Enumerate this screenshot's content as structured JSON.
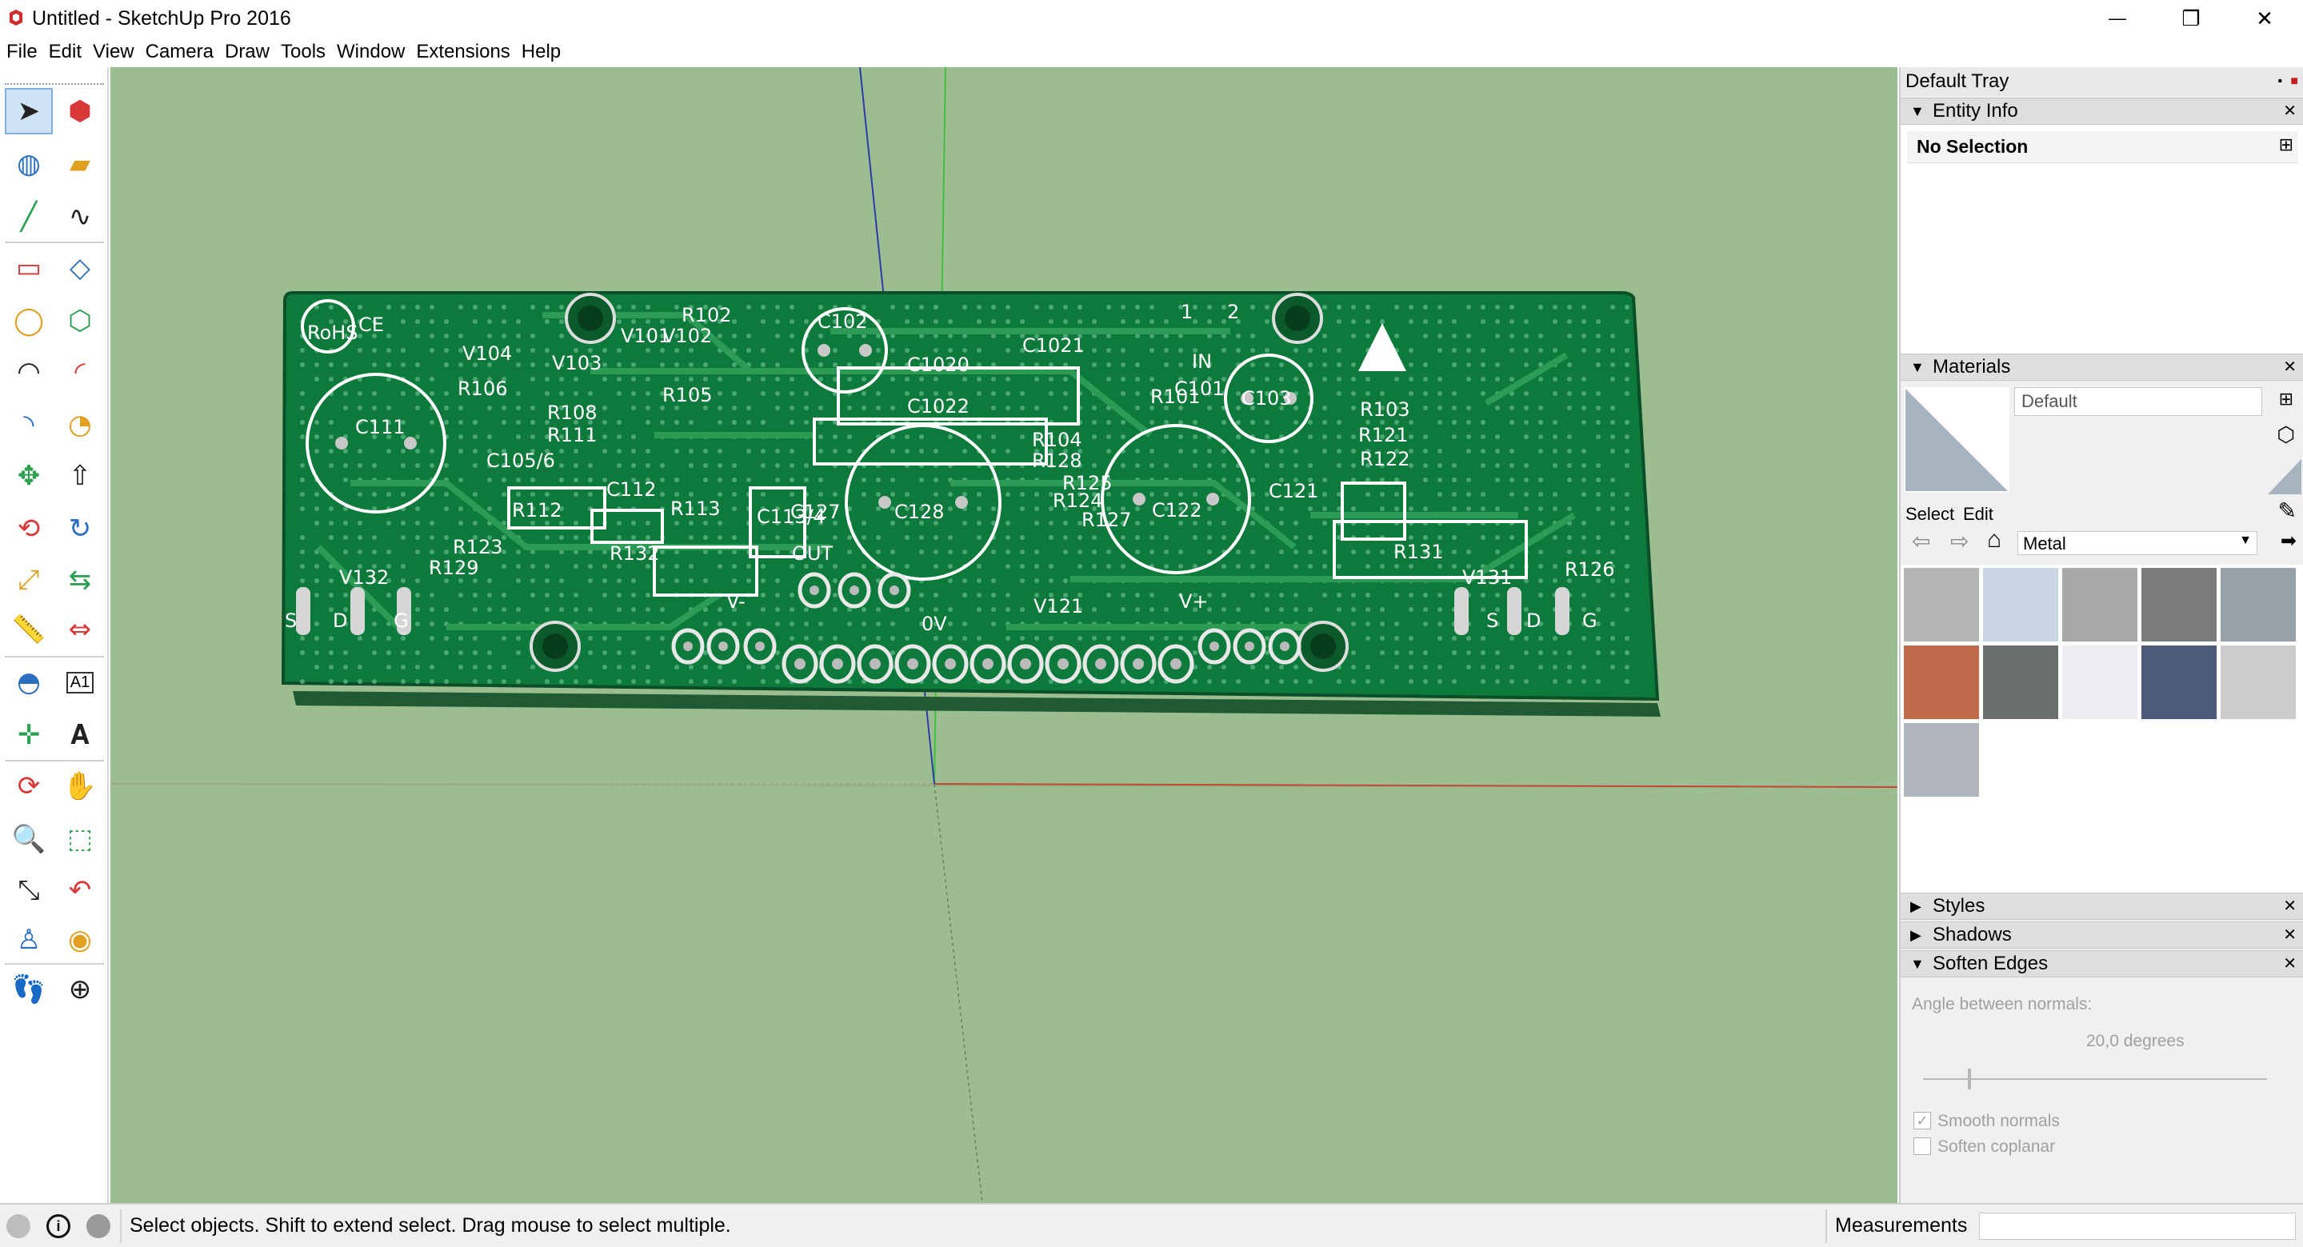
{
  "window": {
    "title": "Untitled - SketchUp Pro 2016",
    "minimize_glyph": "—",
    "maximize_glyph": "❐",
    "close_glyph": "✕"
  },
  "menu": [
    "File",
    "Edit",
    "View",
    "Camera",
    "Draw",
    "Tools",
    "Window",
    "Extensions",
    "Help"
  ],
  "toolbar": {
    "tools": [
      {
        "name": "select-icon"
      },
      {
        "name": "make-component-icon"
      },
      {
        "name": "paint-bucket-icon"
      },
      {
        "name": "eraser-icon"
      },
      {
        "name": "line-icon"
      },
      {
        "name": "freehand-icon"
      },
      {
        "name": "rectangle-icon"
      },
      {
        "name": "rotated-rectangle-icon"
      },
      {
        "name": "circle-icon"
      },
      {
        "name": "polygon-icon"
      },
      {
        "name": "arc-icon"
      },
      {
        "name": "two-point-arc-icon"
      },
      {
        "name": "three-point-arc-icon"
      },
      {
        "name": "pie-icon"
      },
      {
        "name": "move-icon"
      },
      {
        "name": "push-pull-icon"
      },
      {
        "name": "rotate-icon"
      },
      {
        "name": "follow-me-icon"
      },
      {
        "name": "scale-icon"
      },
      {
        "name": "offset-icon"
      },
      {
        "name": "tape-measure-icon"
      },
      {
        "name": "dimension-icon"
      },
      {
        "name": "protractor-icon"
      },
      {
        "name": "text-icon"
      },
      {
        "name": "axes-icon"
      },
      {
        "name": "3d-text-icon"
      },
      {
        "name": "orbit-icon"
      },
      {
        "name": "pan-icon"
      },
      {
        "name": "zoom-icon"
      },
      {
        "name": "zoom-window-icon"
      },
      {
        "name": "zoom-extents-icon"
      },
      {
        "name": "previous-view-icon"
      },
      {
        "name": "position-camera-icon"
      },
      {
        "name": "look-around-icon"
      },
      {
        "name": "walk-icon"
      },
      {
        "name": "section-plane-icon"
      }
    ],
    "dimension_text": "A1"
  },
  "tray": {
    "title": "Default Tray",
    "entity_info": {
      "header": "Entity Info",
      "selection": "No Selection"
    },
    "materials": {
      "header": "Materials",
      "current_name": "Default",
      "tab_select": "Select",
      "tab_edit": "Edit",
      "library": "Metal",
      "swatch_colors": [
        "#b4b6b5",
        "#c9d7e4",
        "#a8a8a8",
        "#7b7c7d",
        "#98a1aa",
        "#c06a4c",
        "#6b6f6e",
        "#ebecf0",
        "#4d5a78",
        "#c9cbcd",
        "#b0b6bb"
      ]
    },
    "styles_header": "Styles",
    "shadows_header": "Shadows",
    "soften_edges": {
      "header": "Soften Edges",
      "angle_label": "Angle between normals:",
      "angle_value": "20,0  degrees",
      "smooth_normals": "Smooth normals",
      "soften_coplanar": "Soften coplanar"
    }
  },
  "pcb": {
    "labels": [
      "RoHS",
      "CE",
      "V104",
      "R106",
      "V103",
      "V101",
      "V102",
      "R102",
      "C102",
      "C1020",
      "C1021",
      "R101",
      "IN",
      "C101",
      "C103",
      "C111",
      "R108",
      "R111",
      "R105",
      "C1022",
      "R103",
      "R121",
      "R122",
      "C105/6",
      "C112",
      "R112",
      "R113",
      "C113/4",
      "C127",
      "C128",
      "R104",
      "R128",
      "R125",
      "R124",
      "R127",
      "R123",
      "C122",
      "C121",
      "R129",
      "R132",
      "OUT",
      "V121",
      "R131",
      "R126",
      "V132",
      "V131",
      "S",
      "D",
      "G",
      "0V",
      "V-",
      "V+",
      "1",
      "2"
    ]
  },
  "status": {
    "text": "Select objects. Shift to extend select. Drag mouse to select multiple.",
    "measurements_label": "Measurements"
  }
}
